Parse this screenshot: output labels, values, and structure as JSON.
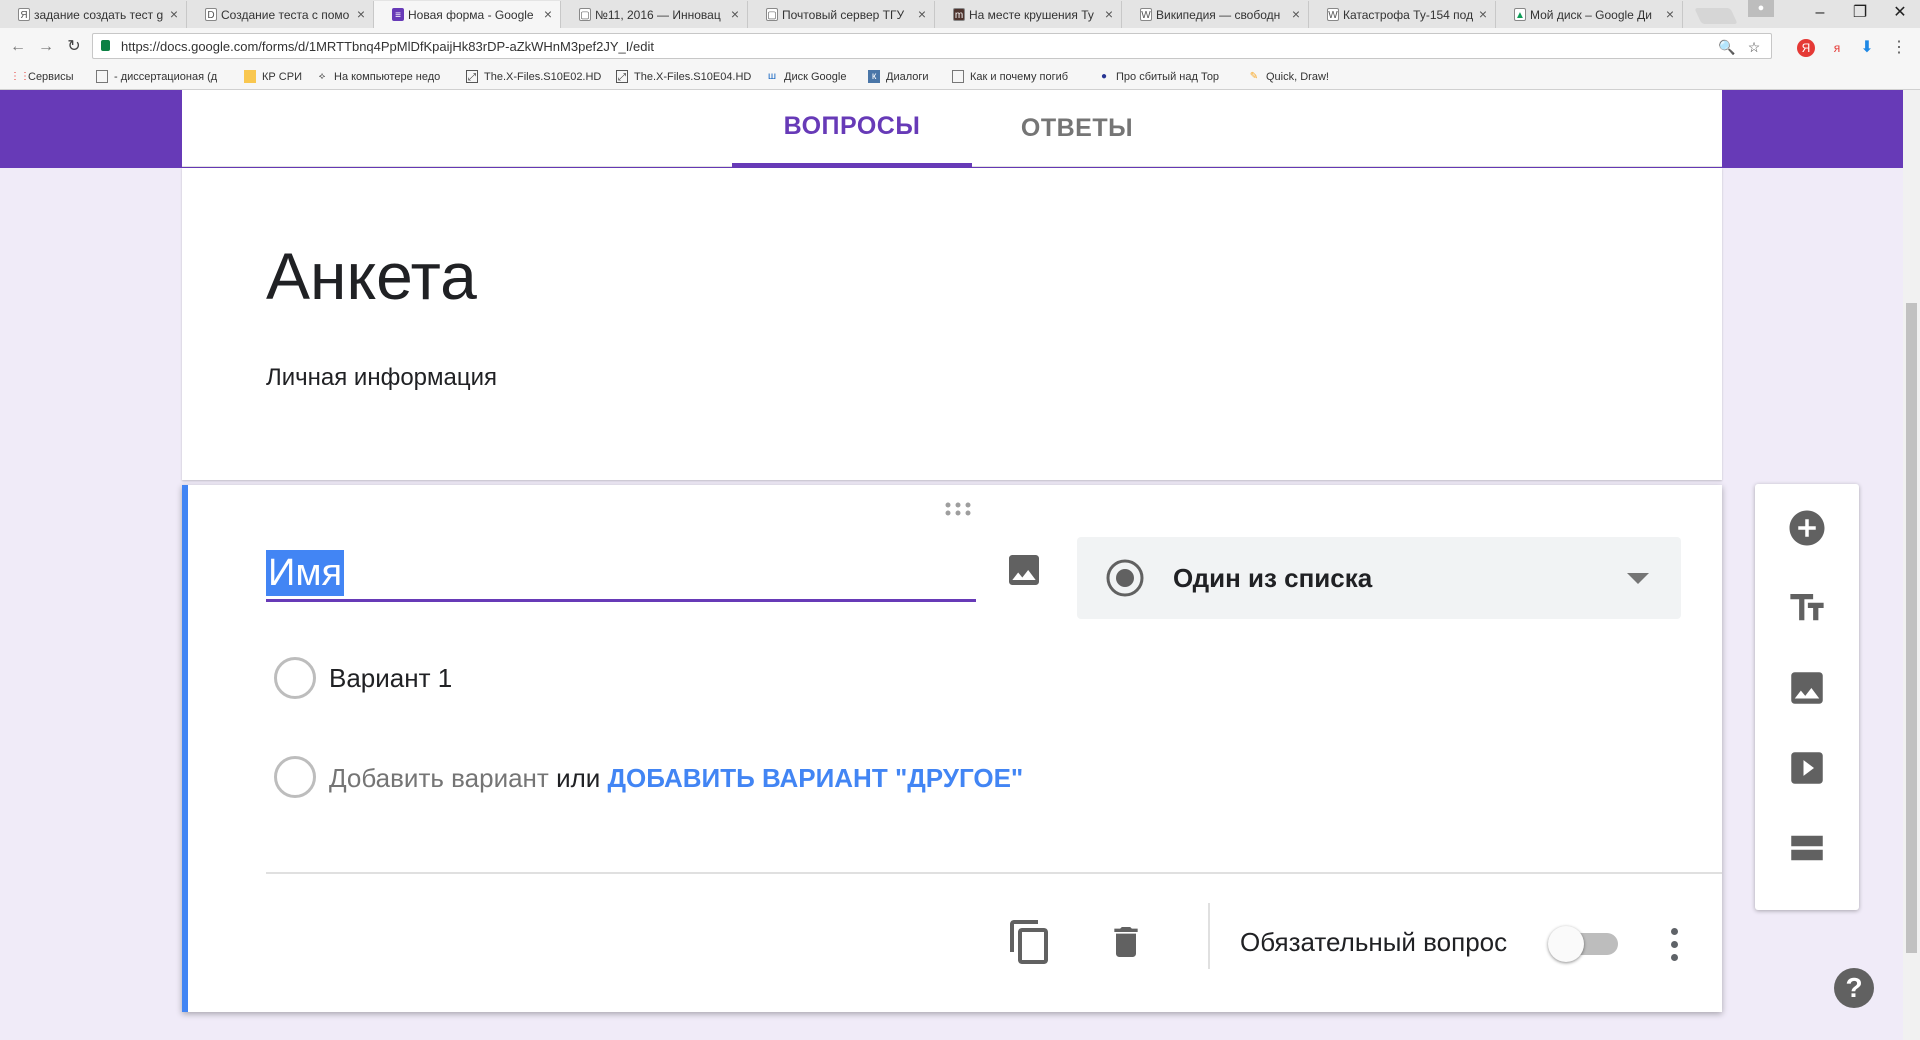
{
  "browser": {
    "tabs": [
      {
        "label": "задание создать тест g",
        "icon": "Я",
        "active": false
      },
      {
        "label": "Создание теста с помо",
        "icon": "D",
        "active": false
      },
      {
        "label": "Новая форма - Google",
        "icon": "≡",
        "active": true
      },
      {
        "label": "№11, 2016 — Инновац",
        "icon": "▢",
        "active": false
      },
      {
        "label": "Почтовый сервер ТГУ",
        "icon": "▢",
        "active": false
      },
      {
        "label": "На месте крушения Ту",
        "icon": "m",
        "active": false
      },
      {
        "label": "Википедия — свободн",
        "icon": "W",
        "active": false
      },
      {
        "label": "Катастрофа Ту-154 под",
        "icon": "W",
        "active": false
      },
      {
        "label": "Мой диск – Google Ди",
        "icon": "▲",
        "active": false
      }
    ],
    "url": "https://docs.google.com/forms/d/1MRTTbnq4PpMlDfKpaijHk83rDP-aZkWHnM3pef2JY_I/edit",
    "bookmarks": [
      {
        "label": "Сервисы",
        "icon": "apps-icon"
      },
      {
        "label": "- диссертационая (д",
        "icon": "page-icon"
      },
      {
        "label": "КР СРИ",
        "icon": "folder-icon"
      },
      {
        "label": "На компьютере недо",
        "icon": "bookmark-icon"
      },
      {
        "label": "The.X-Files.S10E02.HD",
        "icon": "file-icon"
      },
      {
        "label": "The.X-Files.S10E04.HD",
        "icon": "file-icon"
      },
      {
        "label": "Диск Google",
        "icon": "drive-icon"
      },
      {
        "label": "Диалоги",
        "icon": "vk-icon"
      },
      {
        "label": "Как и почему погиб",
        "icon": "page-icon"
      },
      {
        "label": "Про сбитый над Тор",
        "icon": "user-icon"
      },
      {
        "label": "Quick, Draw!",
        "icon": "draw-icon"
      }
    ]
  },
  "form": {
    "tabs": {
      "questions": "ВОПРОСЫ",
      "answers": "ОТВЕТЫ"
    },
    "title": "Анкета",
    "description": "Личная информация",
    "question": {
      "title": "Имя",
      "type": "Один из списка",
      "options": [
        "Вариант 1"
      ],
      "add_option": "Добавить вариант",
      "or": "или",
      "add_other": "ДОБАВИТЬ ВАРИАНТ \"ДРУГОЕ\"",
      "required_label": "Обязательный вопрос",
      "required": false
    }
  },
  "colors": {
    "accent": "#673ab7",
    "background": "#f0ebf8",
    "active_card": "#4285f4",
    "link": "#4285f4"
  }
}
